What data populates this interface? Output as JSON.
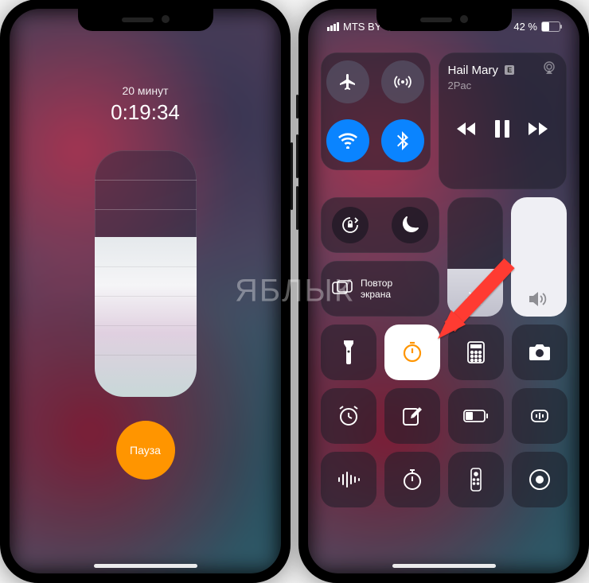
{
  "watermark": "ЯБЛЫК",
  "left": {
    "timer_label": "20 минут",
    "timer_time": "0:19:34",
    "pause_label": "Пауза"
  },
  "right": {
    "status": {
      "carrier": "MTS BY",
      "battery_text": "42 %"
    },
    "media": {
      "title": "Hail Mary",
      "explicit": "E",
      "artist": "2Pac"
    },
    "mirror_label": "Повтор\nэкрана"
  }
}
